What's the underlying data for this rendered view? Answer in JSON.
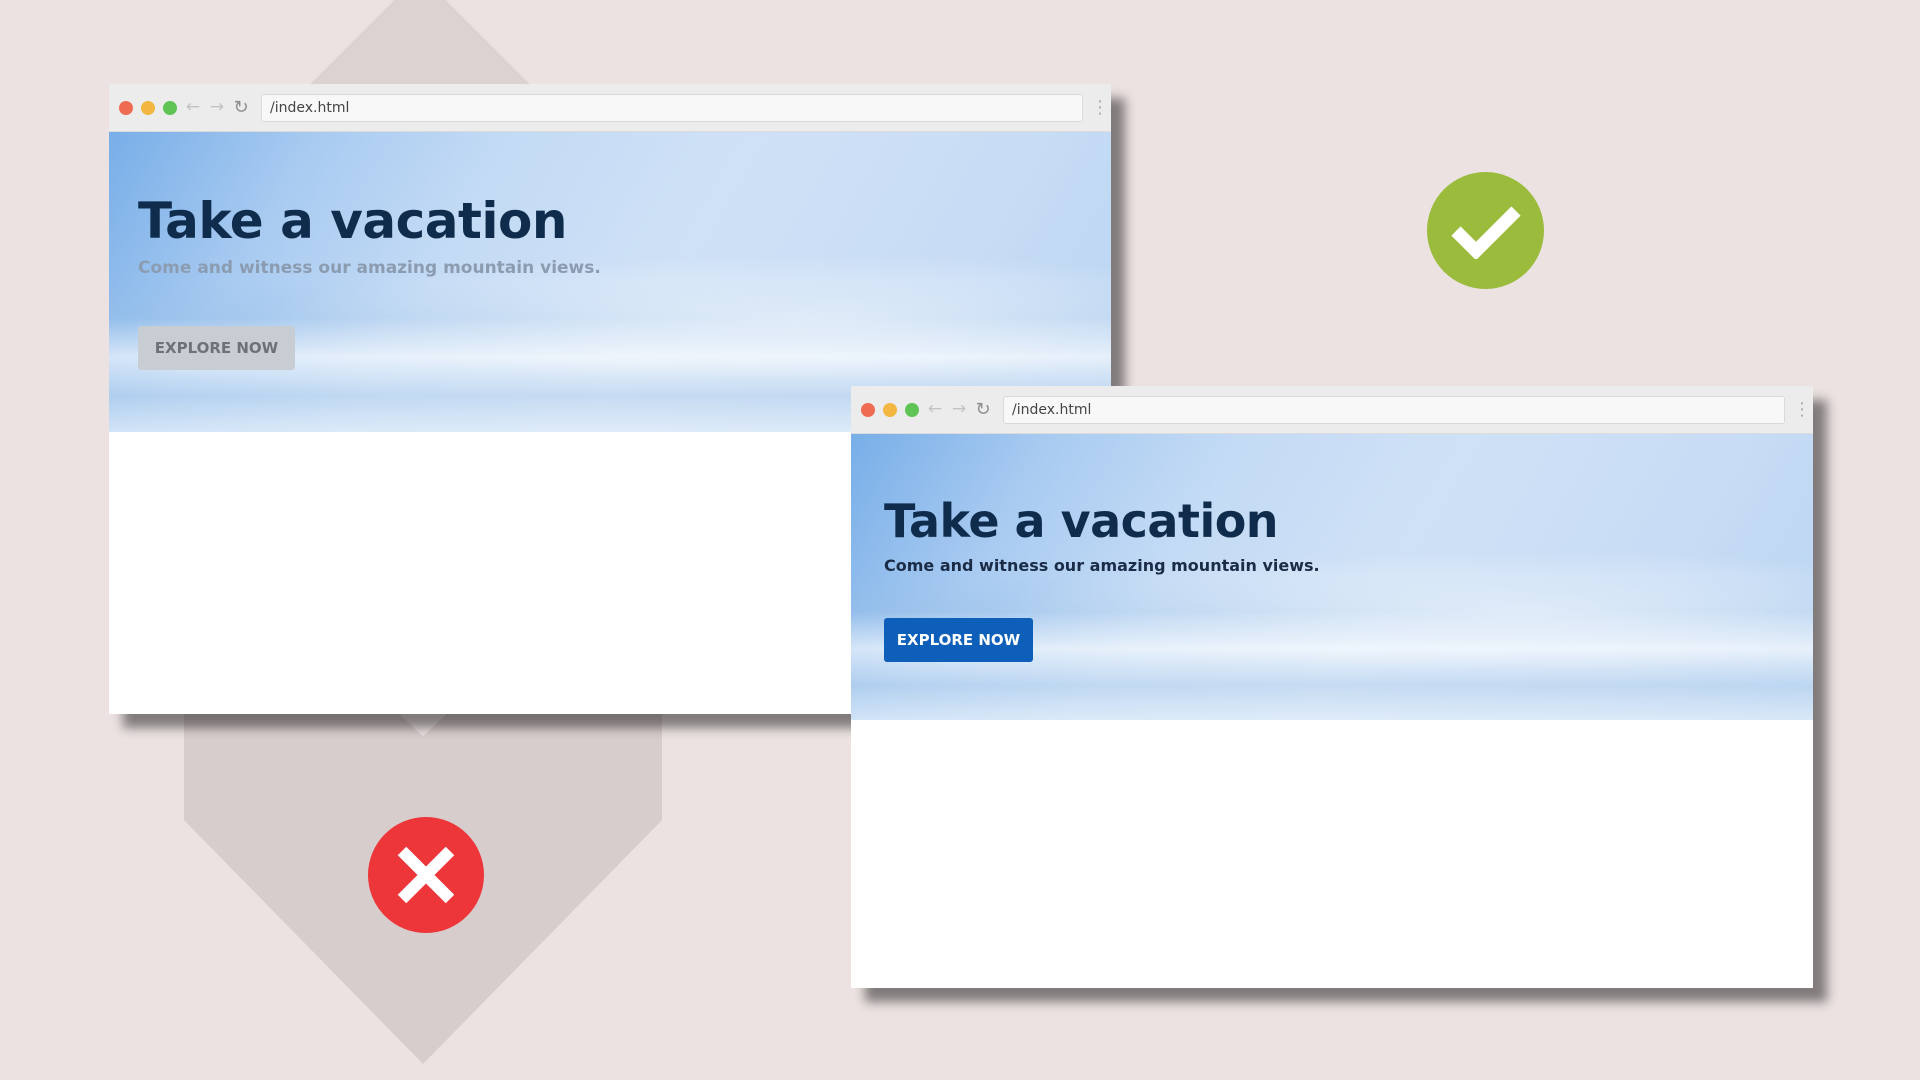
{
  "browsers": {
    "bad": {
      "url": "/index.html",
      "title": "Take a vacation",
      "subtitle": "Come and witness our amazing mountain views.",
      "button_label": "EXPLORE NOW"
    },
    "good": {
      "url": "/index.html",
      "title": "Take a vacation",
      "subtitle": "Come and witness our amazing mountain views.",
      "button_label": "EXPLORE NOW"
    }
  },
  "chrome": {
    "back_icon": "arrow-left-icon",
    "forward_icon": "arrow-right-icon",
    "reload_icon": "reload-icon",
    "menu_icon": "more-vertical-icon"
  },
  "badges": {
    "correct": {
      "icon": "checkmark-icon",
      "color": "#9bbb3c"
    },
    "incorrect": {
      "icon": "cross-icon",
      "color": "#ed3639"
    }
  },
  "colors": {
    "background": "#ebe2e1",
    "title": "#0f2c4d",
    "primary_button": "#0d5fba",
    "disabled_button": "#c8cdd3"
  }
}
